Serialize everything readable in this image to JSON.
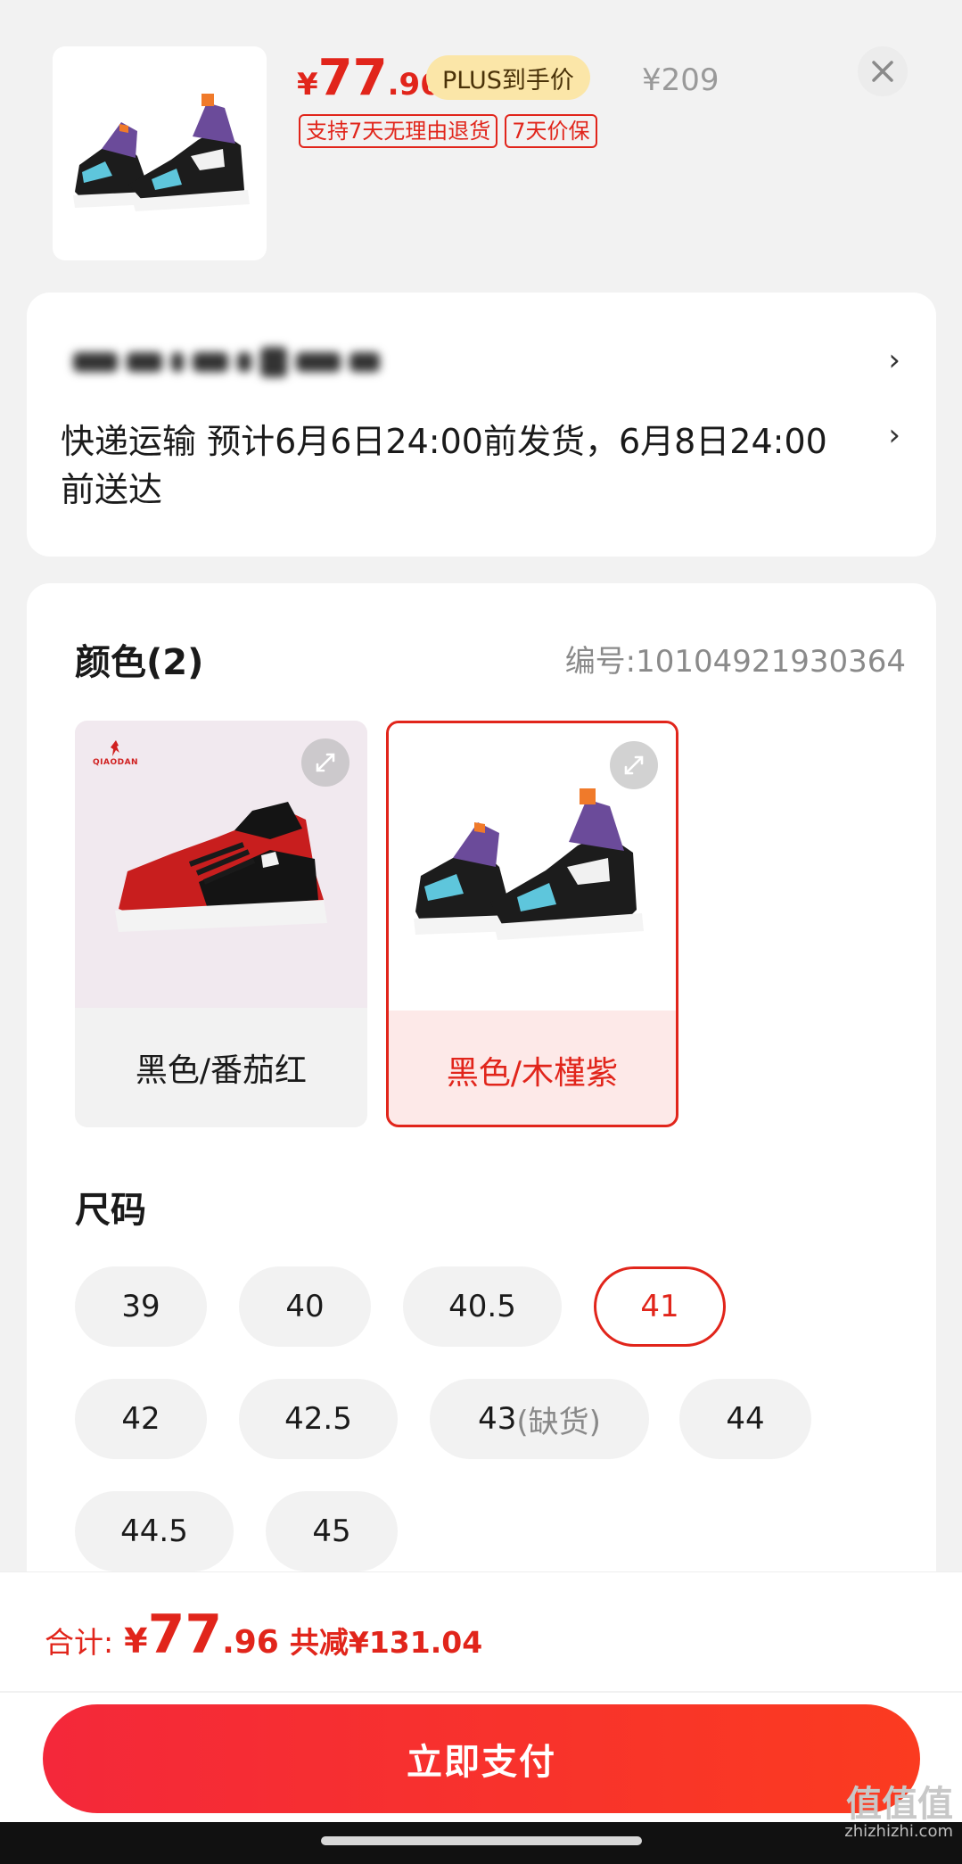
{
  "header": {
    "price_symbol": "¥",
    "price_int": "77",
    "price_dec": ".96",
    "plus_tag": "PLUS到手价",
    "original_price": "¥209",
    "tags": [
      "支持7天无理由退货",
      "7天价保"
    ]
  },
  "shipping": {
    "text": "快递运输 预计6月6日24:00前发货，6月8日24:00前送达"
  },
  "color_section": {
    "title": "颜色(2)",
    "sku": "编号:10104921930364",
    "options": [
      {
        "label": "黑色/番茄红",
        "selected": false,
        "brand_text": "QIAODAN"
      },
      {
        "label": "黑色/木槿紫",
        "selected": true
      }
    ]
  },
  "size_section": {
    "title": "尺码",
    "options": [
      {
        "label": "39"
      },
      {
        "label": "40"
      },
      {
        "label": "40.5"
      },
      {
        "label": "41",
        "selected": true
      },
      {
        "label": "42"
      },
      {
        "label": "42.5"
      },
      {
        "label": "43",
        "suffix": "(缺货)",
        "out_of_stock": true
      },
      {
        "label": "44"
      },
      {
        "label": "44.5"
      },
      {
        "label": "45"
      }
    ]
  },
  "footer": {
    "total_label": "合计:",
    "total_symbol": "¥",
    "total_int": "77",
    "total_dec": ".96",
    "saving": "共减¥131.04",
    "pay_button": "立即支付",
    "watermark_logo": "值值值",
    "watermark_url": "zhizhizhi.com"
  },
  "colors": {
    "accent": "#e1251b",
    "plus_bg": "#fbe6a8",
    "button_start": "#f4283a",
    "button_end": "#fb3b20"
  }
}
